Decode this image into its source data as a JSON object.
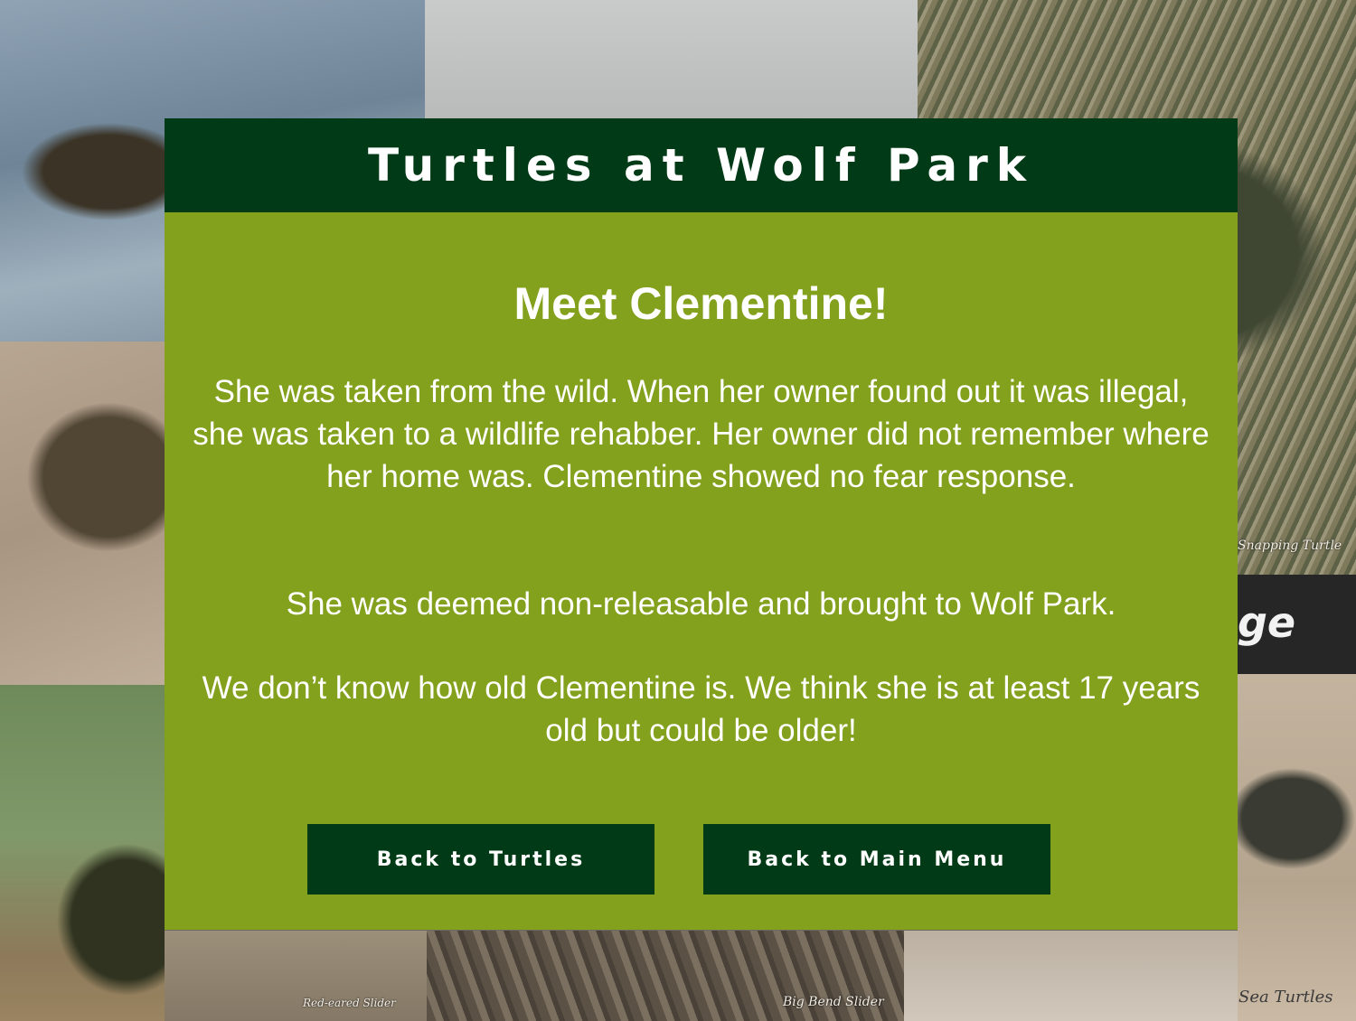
{
  "site": {
    "title": "Turtles at Wolf Park"
  },
  "content": {
    "heading": "Meet Clementine!",
    "paragraphs": [
      "She was taken from the wild. When her owner found out it was illegal, she was taken to a wildlife rehabber. Her owner did not remember where her home was. Clementine showed no fear response.",
      "She was deemed non-releasable and brought to Wolf Park.",
      "We don’t know how old Clementine is. We think she is at least 17 years old but could be older!"
    ]
  },
  "buttons": {
    "back_turtles": "Back to Turtles",
    "back_menu": "Back to Main Menu"
  },
  "background": {
    "captions": {
      "snapping": "Snapping Turtle",
      "red_eared": "Red-eared Slider",
      "big_bend": "Big Bend Slider",
      "sea": "Sea Turtles",
      "partial": "ge"
    }
  },
  "colors": {
    "header_green": "#003a16",
    "panel_green": "#84a11e",
    "button_green": "#003a16",
    "text": "#ffffff"
  }
}
